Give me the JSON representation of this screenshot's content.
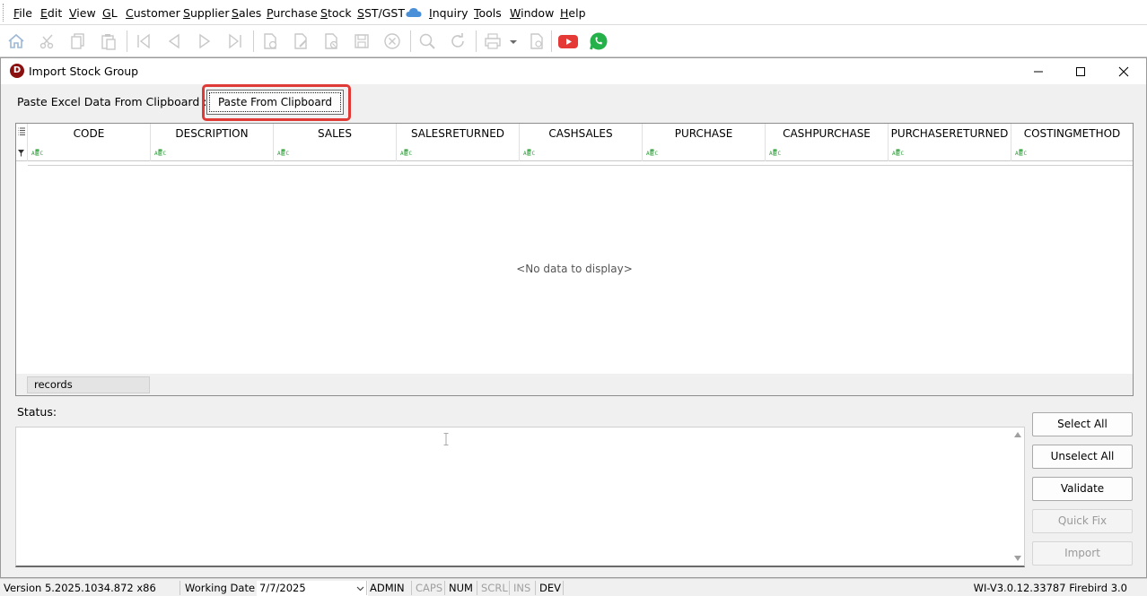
{
  "menu": [
    "File",
    "Edit",
    "View",
    "GL",
    "Customer",
    "Supplier",
    "Sales",
    "Purchase",
    "Stock",
    "SST/GST",
    "Inquiry",
    "Tools",
    "Window",
    "Help"
  ],
  "toolbar_icons": [
    "home-icon",
    "cut-icon",
    "copy-icon",
    "paste-icon",
    "first-record-icon",
    "previous-record-icon",
    "next-record-icon",
    "last-record-icon",
    "new-doc-icon",
    "edit-doc-icon",
    "delete-doc-icon",
    "save-icon",
    "cancel-icon",
    "search-icon",
    "refresh-icon",
    "print-icon",
    "print-dropdown-icon",
    "preview-icon",
    "youtube-icon",
    "whatsapp-icon"
  ],
  "window": {
    "title": "Import Stock Group",
    "logo": "D"
  },
  "paste": {
    "label": "Paste Excel Data From Clipboard :",
    "button": "Paste From Clipboard"
  },
  "grid": {
    "columns": [
      "CODE",
      "DESCRIPTION",
      "SALES",
      "SALESRETURNED",
      "CASHSALES",
      "PURCHASE",
      "CASHPURCHASE",
      "PURCHASERETURNED",
      "COSTINGMETHOD"
    ],
    "empty_message": "<No data to display>",
    "footer": "records"
  },
  "status": {
    "label": "Status:"
  },
  "actions": {
    "select_all": "Select All",
    "unselect_all": "Unselect All",
    "validate": "Validate",
    "quick_fix": "Quick Fix",
    "import": "Import"
  },
  "statusbar": {
    "version": "Version 5.2025.1034.872 x86",
    "working_date_label": "Working Date",
    "working_date": "7/7/2025",
    "user": "ADMIN",
    "caps": "CAPS",
    "num": "NUM",
    "scrl": "SCRL",
    "ins": "INS",
    "dev": "DEV",
    "build": "WI-V3.0.12.33787 Firebird 3.0"
  },
  "colors": {
    "highlight": "#e03a36",
    "logo": "#8b1010",
    "youtube": "#e53935",
    "whatsapp": "#25b14a",
    "cloud": "#4a90d9",
    "abc_green": "#2e9e3a"
  }
}
